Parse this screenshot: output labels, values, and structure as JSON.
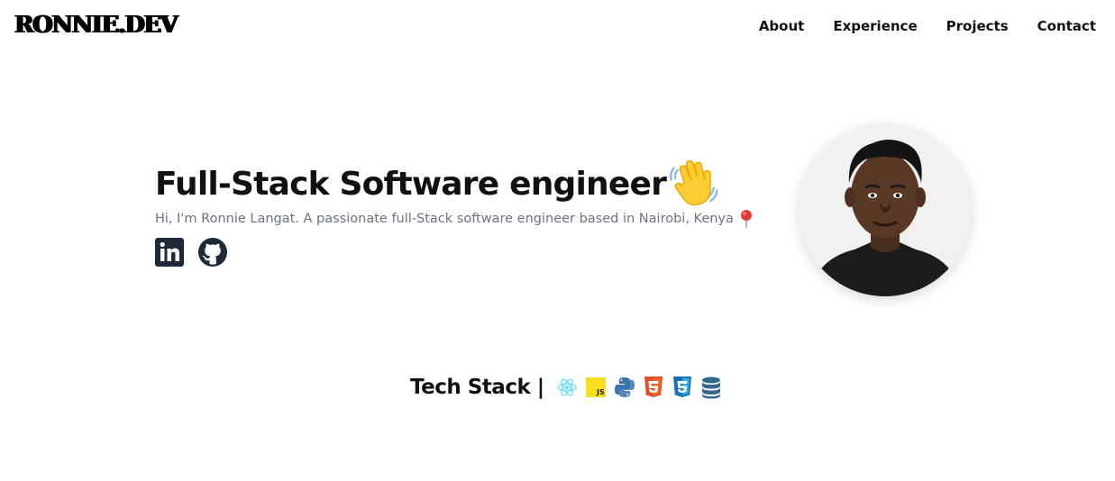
{
  "header": {
    "logo": "RONNIE.DEV",
    "nav": [
      "About",
      "Experience",
      "Projects",
      "Contact"
    ]
  },
  "hero": {
    "title": "Full-Stack Software engineer",
    "subtitle": "Hi, I'm Ronnie Langat. A passionate full-Stack software engineer based in Nairobi, Kenya",
    "socials": [
      "linkedin-icon",
      "github-icon"
    ],
    "title_emoji": "waving-hand-icon",
    "subtitle_emoji": "location-pin-icon"
  },
  "tech_stack": {
    "label": "Tech Stack |",
    "icons": [
      "react-icon",
      "javascript-icon",
      "python-icon",
      "html5-icon",
      "css3-icon",
      "database-icon"
    ]
  },
  "colors": {
    "text": "#111111",
    "muted": "#6b7280",
    "react": "#61dafb",
    "javascript": "#f7df1e",
    "python": "#3776ab",
    "html5": "#e34f26",
    "css3": "#1572b6",
    "database": "#336791"
  }
}
